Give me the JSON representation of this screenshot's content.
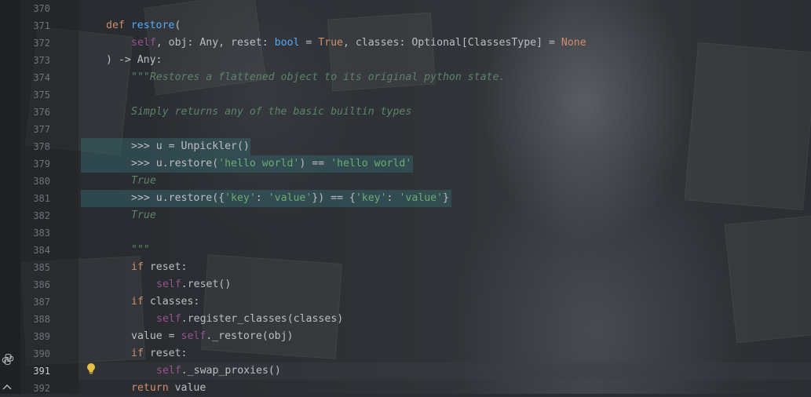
{
  "editor": {
    "lines": [
      {
        "num": "370",
        "indent": 0,
        "tokens": []
      },
      {
        "num": "371",
        "indent": 0,
        "tokens": [
          {
            "t": "def ",
            "c": "kw"
          },
          {
            "t": "restore",
            "c": "fn"
          },
          {
            "t": "(",
            "c": ""
          }
        ]
      },
      {
        "num": "372",
        "indent": 1,
        "tokens": [
          {
            "t": "self",
            "c": "slf"
          },
          {
            "t": ", obj: Any, reset: ",
            "c": ""
          },
          {
            "t": "bool",
            "c": "fn"
          },
          {
            "t": " = ",
            "c": ""
          },
          {
            "t": "True",
            "c": "kw"
          },
          {
            "t": ", classes: Optional[ClassesType] = ",
            "c": ""
          },
          {
            "t": "None",
            "c": "kw"
          }
        ]
      },
      {
        "num": "373",
        "indent": 0,
        "tokens": [
          {
            "t": ") -> Any:",
            "c": ""
          }
        ]
      },
      {
        "num": "374",
        "indent": 1,
        "tokens": [
          {
            "t": "\"\"\"Restores a flattened object to its original python state.",
            "c": "doc"
          }
        ]
      },
      {
        "num": "375",
        "indent": 0,
        "tokens": []
      },
      {
        "num": "376",
        "indent": 1,
        "tokens": [
          {
            "t": "Simply returns any of the basic builtin types",
            "c": "doc"
          }
        ]
      },
      {
        "num": "377",
        "indent": 0,
        "tokens": []
      },
      {
        "num": "378",
        "indent": 1,
        "tokens": [
          {
            "t": ">>> u = Unpickler()",
            "c": ""
          }
        ]
      },
      {
        "num": "379",
        "indent": 1,
        "tokens": [
          {
            "t": ">>> u.restore(",
            "c": ""
          },
          {
            "t": "'hello world'",
            "c": "str"
          },
          {
            "t": ") == ",
            "c": ""
          },
          {
            "t": "'hello world'",
            "c": "str"
          }
        ]
      },
      {
        "num": "380",
        "indent": 1,
        "tokens": [
          {
            "t": "True",
            "c": "doc"
          }
        ]
      },
      {
        "num": "381",
        "indent": 1,
        "tokens": [
          {
            "t": ">>> u.restore({",
            "c": ""
          },
          {
            "t": "'key'",
            "c": "str"
          },
          {
            "t": ": ",
            "c": ""
          },
          {
            "t": "'value'",
            "c": "str"
          },
          {
            "t": "}) == {",
            "c": ""
          },
          {
            "t": "'key'",
            "c": "str"
          },
          {
            "t": ": ",
            "c": ""
          },
          {
            "t": "'value'",
            "c": "str"
          },
          {
            "t": "}",
            "c": ""
          }
        ]
      },
      {
        "num": "382",
        "indent": 1,
        "tokens": [
          {
            "t": "True",
            "c": "doc"
          }
        ]
      },
      {
        "num": "383",
        "indent": 0,
        "tokens": []
      },
      {
        "num": "384",
        "indent": 1,
        "tokens": [
          {
            "t": "\"\"\"",
            "c": "doc"
          }
        ]
      },
      {
        "num": "385",
        "indent": 1,
        "tokens": [
          {
            "t": "if ",
            "c": "kw"
          },
          {
            "t": "reset:",
            "c": ""
          }
        ]
      },
      {
        "num": "386",
        "indent": 2,
        "tokens": [
          {
            "t": "self",
            "c": "slf"
          },
          {
            "t": ".reset()",
            "c": ""
          }
        ]
      },
      {
        "num": "387",
        "indent": 1,
        "tokens": [
          {
            "t": "if ",
            "c": "kw"
          },
          {
            "t": "classes:",
            "c": ""
          }
        ]
      },
      {
        "num": "388",
        "indent": 2,
        "tokens": [
          {
            "t": "self",
            "c": "slf"
          },
          {
            "t": ".register_classes(classes)",
            "c": ""
          }
        ]
      },
      {
        "num": "389",
        "indent": 1,
        "tokens": [
          {
            "t": "value = ",
            "c": ""
          },
          {
            "t": "self",
            "c": "slf"
          },
          {
            "t": "._restore(obj)",
            "c": ""
          }
        ]
      },
      {
        "num": "390",
        "indent": 1,
        "tokens": [
          {
            "t": "if ",
            "c": "kw"
          },
          {
            "t": "reset:",
            "c": ""
          }
        ]
      },
      {
        "num": "391",
        "indent": 2,
        "tokens": [
          {
            "t": "self",
            "c": "slf"
          },
          {
            "t": "._swap_proxies()",
            "c": ""
          }
        ]
      },
      {
        "num": "392",
        "indent": 1,
        "tokens": [
          {
            "t": "return ",
            "c": "kw"
          },
          {
            "t": "value",
            "c": ""
          }
        ]
      }
    ],
    "active_line": "391",
    "highlighted_lines": [
      "378",
      "379",
      "381"
    ],
    "colors": {
      "keyword": "#cf8e6d",
      "function": "#56a8f5",
      "self": "#94558d",
      "docstring": "#5f826b",
      "string": "#6aab73",
      "text": "#bcbec4"
    },
    "gutter_icons": [
      "lightbulb-icon",
      "python-icon",
      "chevron-icon"
    ]
  }
}
